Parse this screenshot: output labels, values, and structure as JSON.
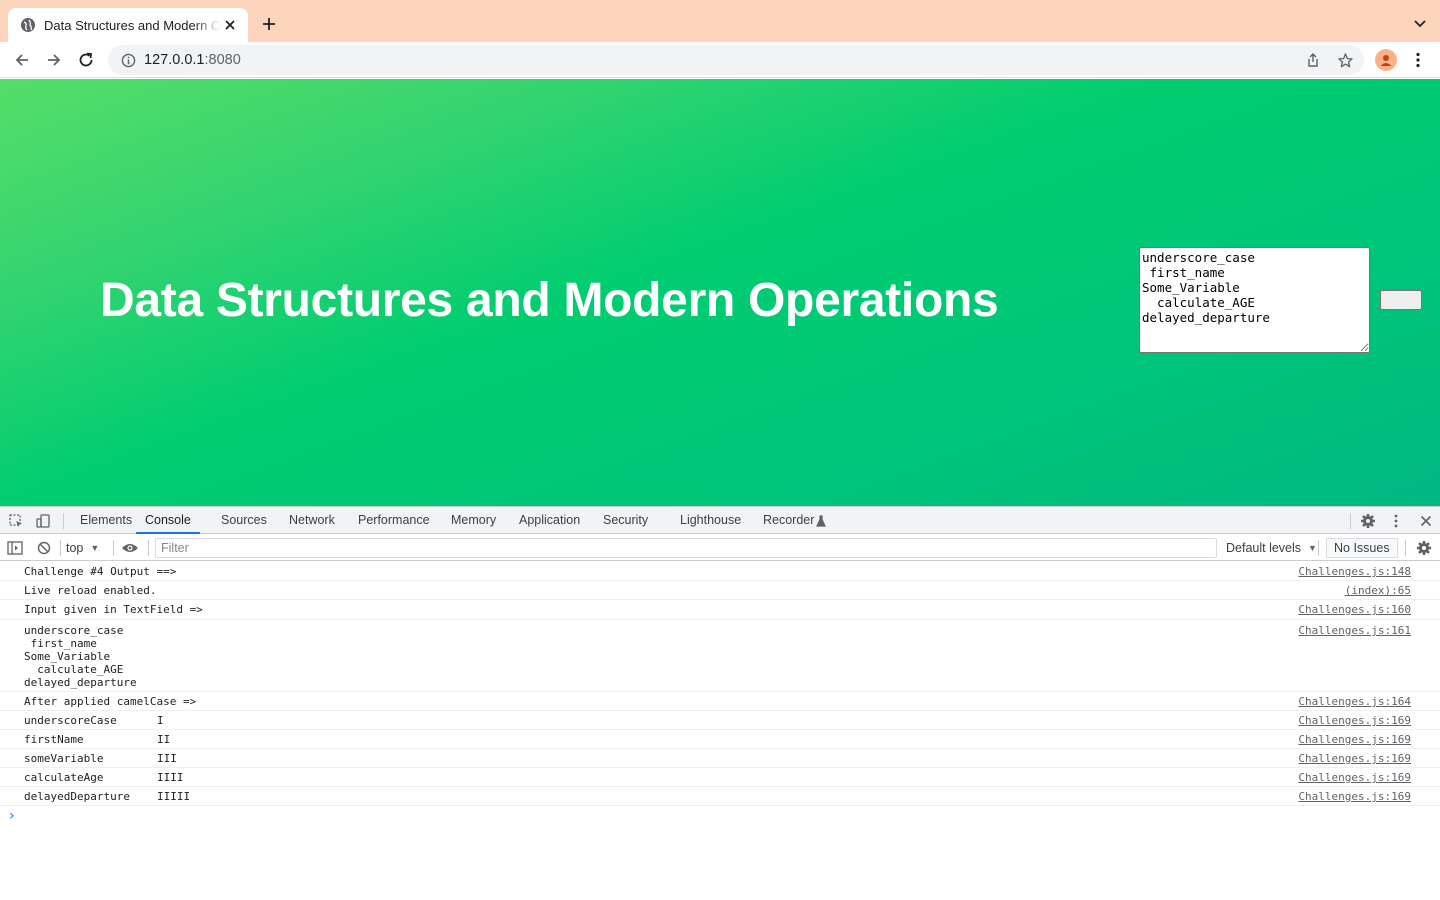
{
  "browser": {
    "tab_title": "Data Structures and Modern Operations",
    "url_host": "127.0.0.1",
    "url_port": ":8080"
  },
  "page": {
    "heading": "Data Structures and Modern Operations",
    "textfield_value": "underscore_case\n first_name\nSome_Variable\n  calculate_AGE\ndelayed_departure",
    "button_label": ""
  },
  "devtools": {
    "tabs": [
      "Elements",
      "Console",
      "Sources",
      "Network",
      "Performance",
      "Memory",
      "Application",
      "Security",
      "Lighthouse",
      "Recorder"
    ],
    "active_tab": "Console",
    "context": "top",
    "filter_placeholder": "Filter",
    "levels": "Default levels",
    "issues": "No Issues"
  },
  "console": {
    "messages": [
      {
        "text": "Challenge #4 Output ==>",
        "source": "Challenges.js:148"
      },
      {
        "text": "Live reload enabled.",
        "source": "(index):65"
      },
      {
        "text": "Input given in TextField =>",
        "source": "Challenges.js:160"
      },
      {
        "text": "underscore_case\n first_name\nSome_Variable\n  calculate_AGE\ndelayed_departure",
        "source": "Challenges.js:161"
      },
      {
        "text": "After applied camelCase =>",
        "source": "Challenges.js:164"
      },
      {
        "text": "underscoreCase",
        "count": "I",
        "source": "Challenges.js:169"
      },
      {
        "text": "firstName",
        "count": "II",
        "source": "Challenges.js:169"
      },
      {
        "text": "someVariable",
        "count": "III",
        "source": "Challenges.js:169"
      },
      {
        "text": "calculateAge",
        "count": "IIII",
        "source": "Challenges.js:169"
      },
      {
        "text": "delayedDeparture",
        "count": "IIIII",
        "source": "Challenges.js:169"
      }
    ],
    "prompt": "›"
  }
}
